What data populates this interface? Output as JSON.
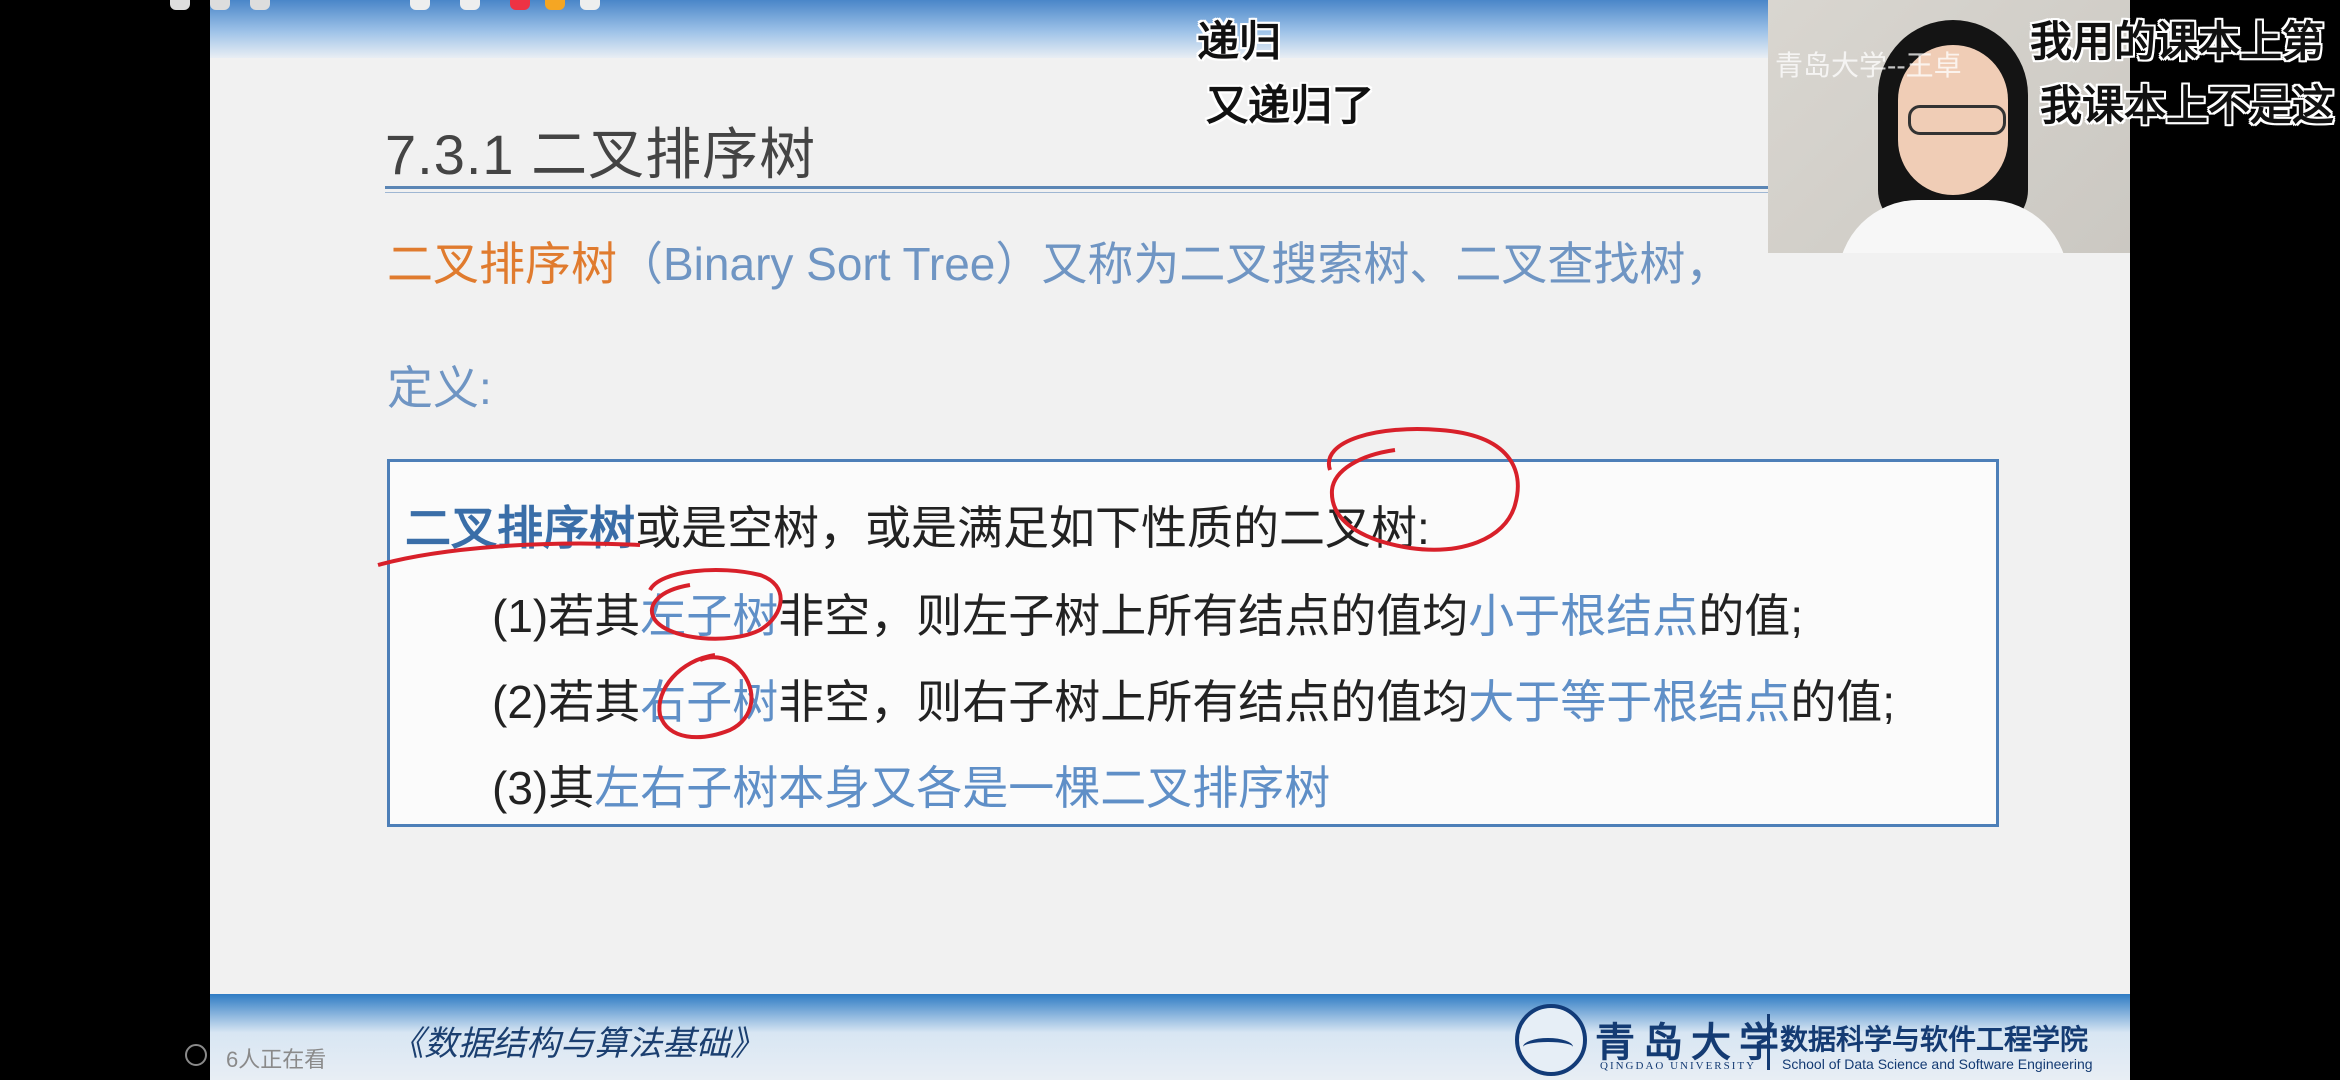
{
  "slide": {
    "title": "7.3.1 二叉排序树",
    "intro_term": "二叉排序树",
    "intro_rest": "（Binary Sort Tree）又称为二叉搜索树、二叉查找树，",
    "definition_label": "定义:",
    "box": {
      "line0_term": "二叉排序树",
      "line0_rest": "或是空树，或是满足如下性质的二叉树:",
      "line1_a": "(1)若其",
      "line1_b": "左子树",
      "line1_c": "非空，则左子树上所有结点的值均",
      "line1_d": "小于根结点",
      "line1_e": "的值;",
      "line2_a": "(2)若其",
      "line2_b": "右子树",
      "line2_c": "非空，则右子树上所有结点的值均",
      "line2_d": "大于等于根结点",
      "line2_e": "的值;",
      "line3_a": "(3)其",
      "line3_b": "左右子树本身又各是一棵二叉排序树"
    },
    "footer_book": "《数据结构与算法基础》",
    "university_cn": "青岛大学",
    "university_en": "QINGDAO UNIVERSITY",
    "school_cn": "数据科学与软件工程学院",
    "school_en": "School of Data Science and Software Engineering"
  },
  "overlay": {
    "subtitle_center_1": "递归",
    "subtitle_center_2": "又递归了",
    "subtitle_right_1": "我用的课本上第",
    "subtitle_right_2": "我课本上不是这",
    "webcam_watermark": "青岛大学--王卓",
    "viewers": "6人正在看"
  },
  "colors": {
    "accent_orange": "#e07b2e",
    "accent_blue": "#6f95c3",
    "box_border": "#4d7fb8",
    "annotation_red": "#d8202a"
  }
}
